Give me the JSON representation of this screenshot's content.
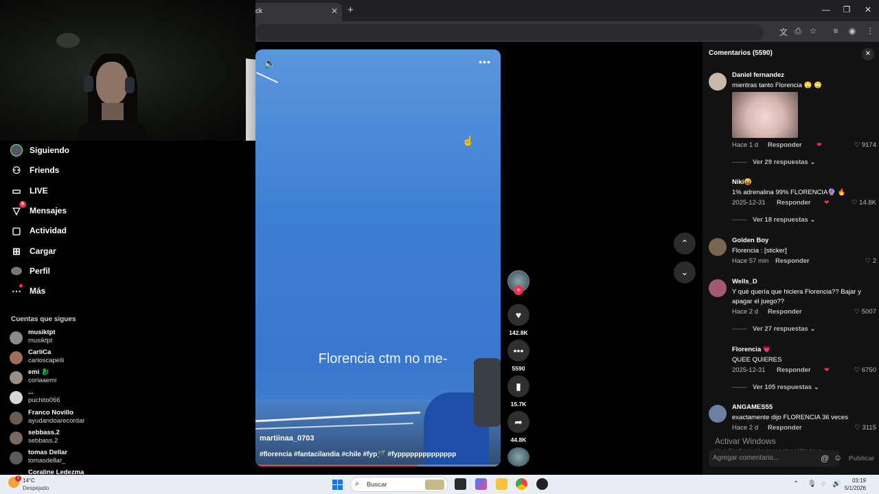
{
  "browser": {
    "tab_title": "ck",
    "tab_close": "✕",
    "new_tab": "+",
    "window_controls": [
      "—",
      "❐",
      "✕"
    ]
  },
  "nav": {
    "items": [
      {
        "label": "Siguiendo",
        "icon": "following-avatar-icon"
      },
      {
        "label": "Friends",
        "icon": "friends-icon"
      },
      {
        "label": "LIVE",
        "icon": "live-icon"
      },
      {
        "label": "Mensajes",
        "icon": "messages-icon",
        "badge": "5"
      },
      {
        "label": "Actividad",
        "icon": "activity-icon"
      },
      {
        "label": "Cargar",
        "icon": "upload-icon"
      },
      {
        "label": "Perfil",
        "icon": "profile-avatar-icon"
      },
      {
        "label": "Más",
        "icon": "more-icon"
      }
    ],
    "following_title": "Cuentas que sigues",
    "following": [
      {
        "name": "musiktpt",
        "handle": "musiktpt"
      },
      {
        "name": "CarliCa",
        "handle": "carloscapelli"
      },
      {
        "name": "emi 🐉",
        "handle": "coriaaemi"
      },
      {
        "name": "...",
        "handle": "puchito066"
      },
      {
        "name": "Franco Novillo",
        "handle": "ayudandoarecordar"
      },
      {
        "name": "sebbass.2",
        "handle": "sebbass.2"
      },
      {
        "name": "tomas Dellar",
        "handle": "tomasdellar_"
      },
      {
        "name": "Coraline Ledezma",
        "handle": ""
      }
    ]
  },
  "video": {
    "caption": "Florencia ctm no me-",
    "author": "martiinaa_0703",
    "hashtags": "#florencia #fantacilandia #chile #fyp🪄 #fypppppppppppppp",
    "progress": 0.66
  },
  "actions": {
    "likes": "142.8K",
    "comments": "5590",
    "saves": "15.7K",
    "shares": "44.8K"
  },
  "comments_panel": {
    "title": "Comentarios (5590)",
    "close": "✕",
    "reply_label": "Responder",
    "items": [
      {
        "user": "Daniel fernandez",
        "text": "mientras tanto Florencia 🙄 🙄",
        "time": "Hace 1 d",
        "likes": "9174",
        "replies": "Ver 29 respuestas",
        "has_sticker": true,
        "creator_liked": true
      },
      {
        "user": "Niki😝",
        "text": "1% adrenalina 99% FLORENCIA🔮 🔥",
        "time": "2025-12-31",
        "likes": "14.8K",
        "replies": "Ver 18 respuestas",
        "creator_liked": true
      },
      {
        "user": "Golden Boy",
        "text": "Florencia : [sticker]",
        "time": "Hace 57 min",
        "likes": "2"
      },
      {
        "user": "Wells_D",
        "text": "Y qué quería que hiciera Florencia?? Bajar y apagar el juego??",
        "time": "Hace 2 d",
        "likes": "5007",
        "replies": "Ver 27 respuestas"
      },
      {
        "user": "Florencia 💗",
        "text": "QUEE QUIERES",
        "time": "2025-12-31",
        "likes": "6750",
        "replies": "Ver 105 respuestas",
        "creator_liked": true
      },
      {
        "user": "ANGAMES55",
        "text": "exactamente dijo FLORENCIA 36 veces",
        "time": "Hace 2 d",
        "likes": "3115"
      }
    ],
    "input_placeholder": "Agregar comentario...",
    "publish_label": "Publicar",
    "watermark_title": "Activar Windows",
    "watermark_sub": "Ve a Configuración para activar Windows."
  },
  "taskbar": {
    "temp": "14°C",
    "condition": "Despejado",
    "weather_badge": "1",
    "search_placeholder": "Buscar",
    "time": "03:19",
    "date": "5/1/2026"
  }
}
